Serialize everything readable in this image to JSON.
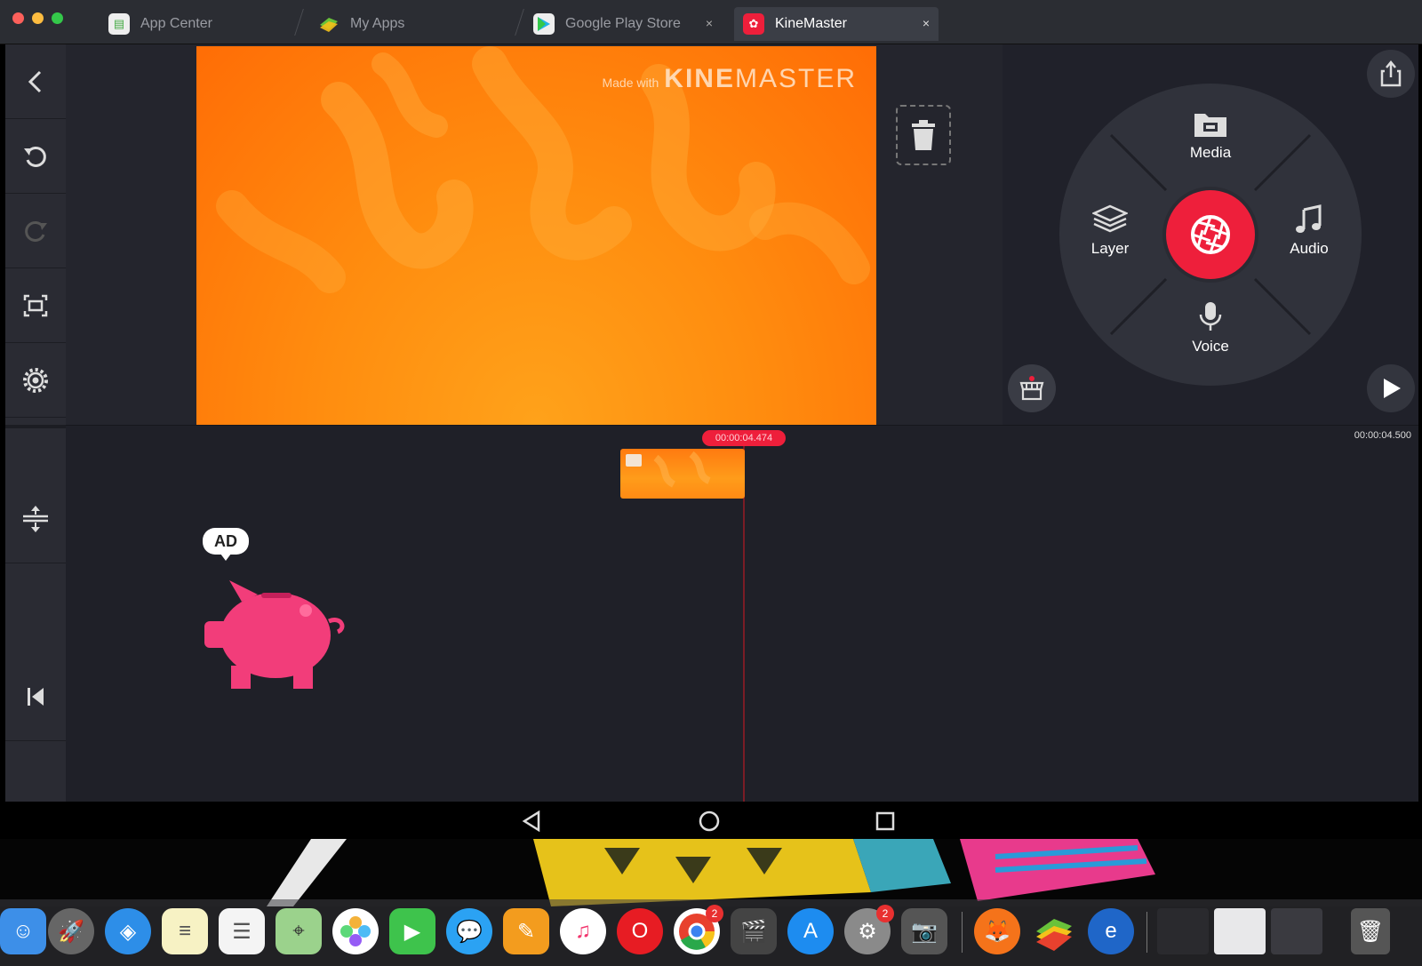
{
  "window": {
    "tabs": [
      {
        "label": "App Center",
        "active": false,
        "closable": false
      },
      {
        "label": "My Apps",
        "active": false,
        "closable": false
      },
      {
        "label": "Google Play Store",
        "active": false,
        "closable": true
      },
      {
        "label": "KineMaster",
        "active": true,
        "closable": true
      }
    ],
    "close_glyph": "×"
  },
  "preview": {
    "watermark_prefix": "Made with",
    "watermark_brand_bold": "KINE",
    "watermark_brand_light": "MASTER"
  },
  "wheel": {
    "media_label": "Media",
    "layer_label": "Layer",
    "audio_label": "Audio",
    "voice_label": "Voice"
  },
  "timeline": {
    "playhead_time": "00:00:04.474",
    "end_time": "00:00:04.500",
    "ad_label": "AD"
  },
  "icons": {
    "back": "chevron-left-icon",
    "undo": "undo-icon",
    "redo": "redo-icon",
    "screenshot": "capture-frame-icon",
    "settings": "gear-icon",
    "expand": "expand-tracks-icon",
    "jump_start": "skip-to-start-icon",
    "share": "share-icon",
    "store": "asset-store-icon",
    "play": "play-icon",
    "delete": "trash-icon"
  },
  "dock": {
    "chrome_badge": "2",
    "settings_badge": "2"
  },
  "colors": {
    "accent": "#ee1f3b",
    "preview_orange": "#ff8d0f",
    "piggy_pink": "#f23d7a"
  }
}
